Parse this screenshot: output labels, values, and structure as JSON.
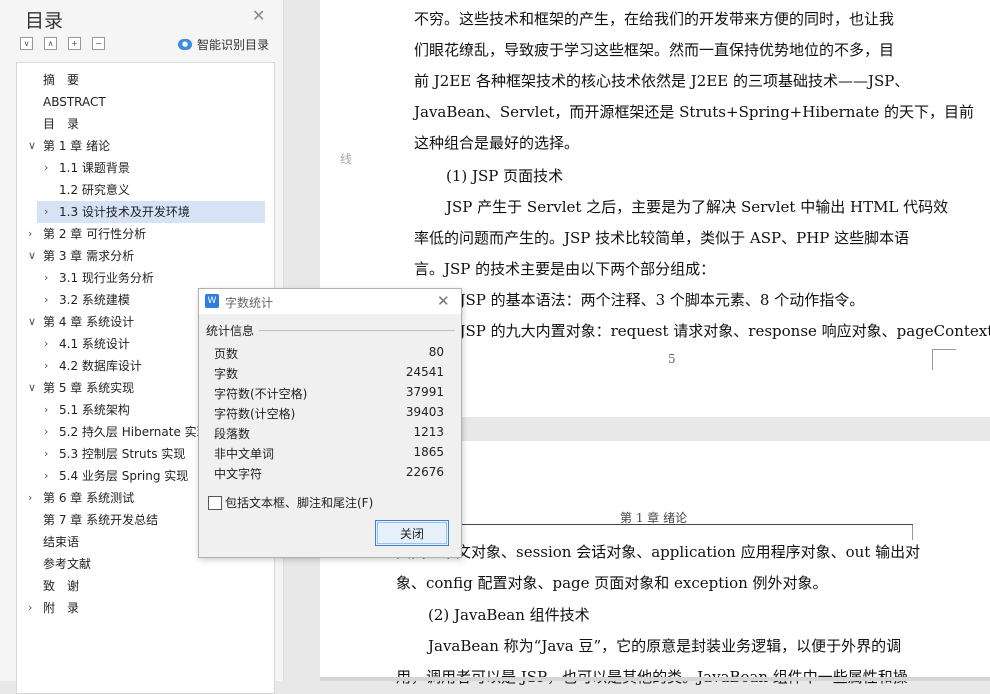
{
  "nav": {
    "title": "目录",
    "smart_label": "智能识别目录",
    "toc": [
      {
        "label": "摘　要",
        "level": 0,
        "arrow": "",
        "selected": false
      },
      {
        "label": "ABSTRACT",
        "level": 0,
        "arrow": "",
        "selected": false
      },
      {
        "label": "目　录",
        "level": 0,
        "arrow": "",
        "selected": false
      },
      {
        "label": "第 1 章  绪论",
        "level": 0,
        "arrow": "∨",
        "selected": false
      },
      {
        "label": "1.1  课题背景",
        "level": 1,
        "arrow": "›",
        "selected": false
      },
      {
        "label": "1.2  研究意义",
        "level": 1,
        "arrow": "",
        "selected": false
      },
      {
        "label": "1.3  设计技术及开发环境",
        "level": 1,
        "arrow": "›",
        "selected": true
      },
      {
        "label": "第 2 章  可行性分析",
        "level": 0,
        "arrow": "›",
        "selected": false
      },
      {
        "label": "第 3 章  需求分析",
        "level": 0,
        "arrow": "∨",
        "selected": false
      },
      {
        "label": "3.1  现行业务分析",
        "level": 1,
        "arrow": "›",
        "selected": false
      },
      {
        "label": "3.2  系统建模",
        "level": 1,
        "arrow": "›",
        "selected": false
      },
      {
        "label": "第 4 章  系统设计",
        "level": 0,
        "arrow": "∨",
        "selected": false
      },
      {
        "label": "4.1  系统设计",
        "level": 1,
        "arrow": "›",
        "selected": false
      },
      {
        "label": "4.2  数据库设计",
        "level": 1,
        "arrow": "›",
        "selected": false
      },
      {
        "label": "第 5 章  系统实现",
        "level": 0,
        "arrow": "∨",
        "selected": false
      },
      {
        "label": "5.1  系统架构",
        "level": 1,
        "arrow": "›",
        "selected": false
      },
      {
        "label": "5.2  持久层 Hibernate 实现",
        "level": 1,
        "arrow": "›",
        "selected": false
      },
      {
        "label": "5.3  控制层 Struts 实现",
        "level": 1,
        "arrow": "›",
        "selected": false
      },
      {
        "label": "5.4  业务层 Spring 实现",
        "level": 1,
        "arrow": "›",
        "selected": false
      },
      {
        "label": "第 6 章  系统测试",
        "level": 0,
        "arrow": "›",
        "selected": false
      },
      {
        "label": "第 7 章  系统开发总结",
        "level": 0,
        "arrow": "",
        "selected": false
      },
      {
        "label": "结束语",
        "level": 0,
        "arrow": "",
        "selected": false
      },
      {
        "label": "参考文献",
        "level": 0,
        "arrow": "",
        "selected": false
      },
      {
        "label": "致　谢",
        "level": 0,
        "arrow": "",
        "selected": false
      },
      {
        "label": "附　录",
        "level": 0,
        "arrow": "›",
        "selected": false
      }
    ]
  },
  "doc": {
    "margin_mark": "线",
    "page1_lines": [
      "不穷。这些技术和框架的产生，在给我们的开发带来方便的同时，也让我",
      "们眼花缭乱，导致疲于学习这些框架。然而一直保持优势地位的不多，目",
      "前 J2EE 各种框架技术的核心技术依然是 J2EE 的三项基础技术——JSP、",
      "JavaBean、Servlet，而开源框架还是 Struts+Spring+Hibernate 的天下，目前",
      "这种组合是最好的选择。",
      "(1) JSP 页面技术",
      "JSP 产生于 Servlet 之后，主要是为了解决 Servlet 中输出 HTML 代码效",
      "率低的问题而产生的。JSP 技术比较简单，类似于 ASP、PHP 这些脚本语",
      "言。JSP 的技术主要是由以下两个部分组成：",
      "①JSP 的基本语法：两个注释、3 个脚本元素、8 个动作指令。",
      "②JSP 的九大内置对象：request 请求对象、response 响应对象、pageContext"
    ],
    "page_number": "5",
    "page2_header": "第 1 章  绪论",
    "page2_lines": [
      "页面上下文对象、session 会话对象、application 应用程序对象、out 输出对",
      "象、config 配置对象、page 页面对象和 exception 例外对象。",
      "(2) JavaBean 组件技术",
      "JavaBean 称为“Java 豆”，它的原意是封装业务逻辑，以便于外界的调",
      "用，调用者可以是 JSP，也可以是其他的类。JavaBean 组件中一些属性和操"
    ]
  },
  "dialog": {
    "title": "字数统计",
    "group_title": "统计信息",
    "stats": [
      {
        "label": "页数",
        "value": "80"
      },
      {
        "label": "字数",
        "value": "24541"
      },
      {
        "label": "字符数(不计空格)",
        "value": "37991"
      },
      {
        "label": "字符数(计空格)",
        "value": "39403"
      },
      {
        "label": "段落数",
        "value": "1213"
      },
      {
        "label": "非中文单词",
        "value": "1865"
      },
      {
        "label": "中文字符",
        "value": "22676"
      }
    ],
    "checkbox_label": "包括文本框、脚注和尾注(F)",
    "checkbox_checked": false,
    "close_label": "关闭"
  }
}
